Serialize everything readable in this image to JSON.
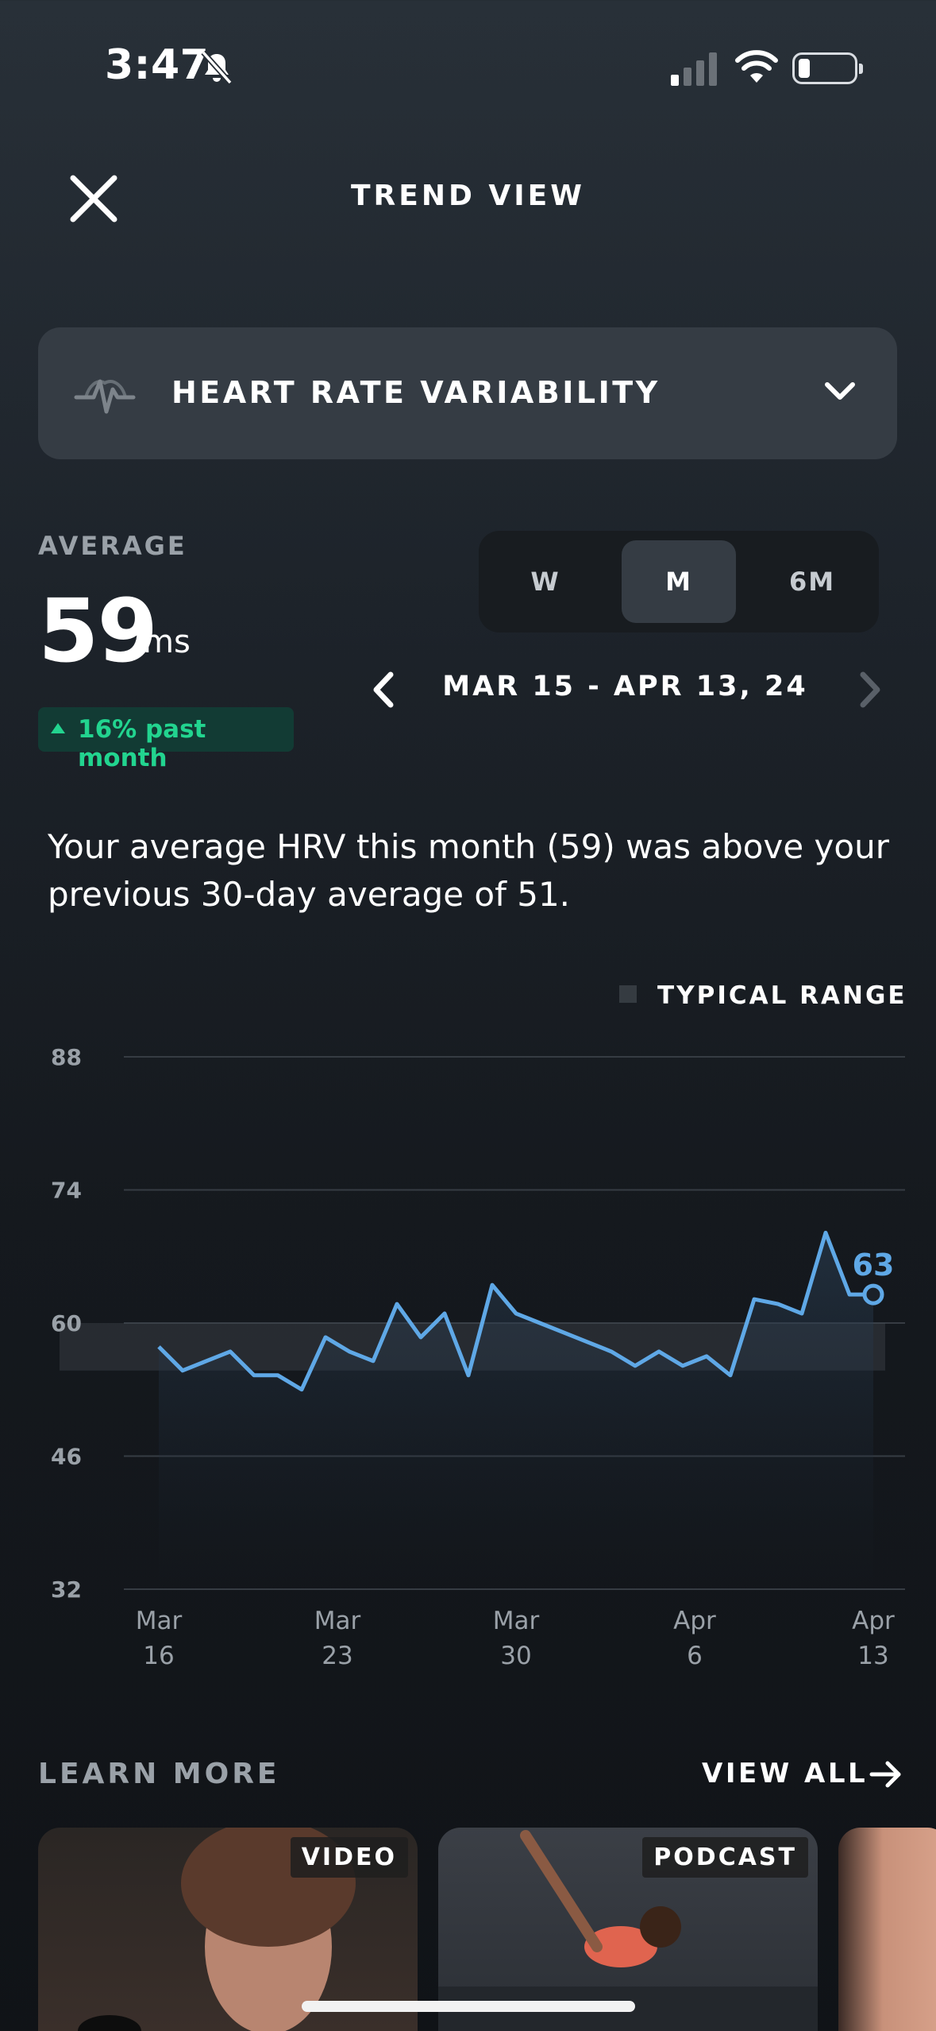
{
  "status_bar": {
    "time": "3:47"
  },
  "header": {
    "title": "TREND VIEW"
  },
  "metric_selector": {
    "label": "HEART RATE VARIABILITY"
  },
  "average": {
    "label": "AVERAGE",
    "value": "59",
    "unit": "ms",
    "change_text": "16% past month"
  },
  "period_tabs": [
    {
      "label": "W",
      "selected": false
    },
    {
      "label": "M",
      "selected": true
    },
    {
      "label": "6M",
      "selected": false
    }
  ],
  "date_range": "MAR 15 - APR 13, 24",
  "summary": "Your average HRV this month (59) was above your previous 30-day average of 51.",
  "legend": {
    "typical_range": "TYPICAL RANGE"
  },
  "chart_data": {
    "type": "line",
    "y_ticks": [
      "88",
      "74",
      "60",
      "46",
      "32"
    ],
    "ylim": [
      32,
      88
    ],
    "x_ticks": [
      {
        "line1": "Mar",
        "line2": "16"
      },
      {
        "line1": "Mar",
        "line2": "23"
      },
      {
        "line1": "Mar",
        "line2": "30"
      },
      {
        "line1": "Apr",
        "line2": "6"
      },
      {
        "line1": "Apr",
        "line2": "13"
      }
    ],
    "typical_range": [
      55,
      60
    ],
    "values": [
      57.5,
      55,
      56,
      57,
      54.5,
      54.5,
      53,
      58.5,
      57,
      56,
      62,
      58.5,
      61,
      54.5,
      64,
      61,
      60,
      59,
      58,
      57,
      55.5,
      57,
      55.5,
      56.5,
      54.5,
      62.5,
      62,
      61,
      69.5,
      63,
      63
    ],
    "last_value_label": "63"
  },
  "learn_more": {
    "title": "LEARN MORE",
    "view_all": "VIEW ALL",
    "cards": [
      {
        "badge": "VIDEO"
      },
      {
        "badge": "PODCAST"
      },
      {
        "badge": ""
      }
    ]
  },
  "colors": {
    "accent_line": "#5fa8e6",
    "positive": "#22d48f"
  },
  "icons": [
    "bell-slash-icon",
    "signal-icon",
    "wifi-icon",
    "battery-icon",
    "close-icon",
    "pulse-icon",
    "chevron-down-icon",
    "chevron-left-icon",
    "chevron-right-icon",
    "arrow-right-icon"
  ]
}
